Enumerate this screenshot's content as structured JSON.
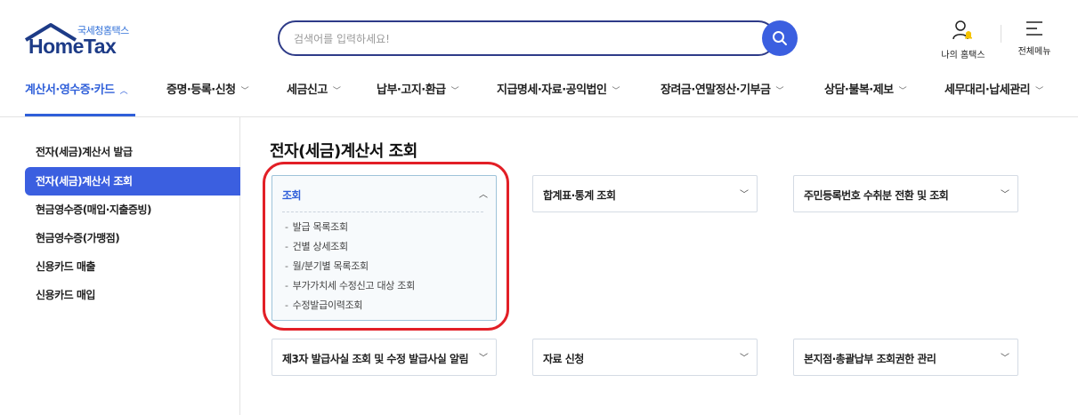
{
  "header": {
    "logo_sub": "국세청홈택스",
    "logo_main": "HomeTax",
    "search_placeholder": "검색어를 입력하세요!",
    "my_hometax": "나의 홈택스",
    "all_menu": "전체메뉴"
  },
  "gnb": [
    {
      "label": "계산서·영수증·카드",
      "chev": "︿"
    },
    {
      "label": "증명·등록·신청",
      "chev": "﹀"
    },
    {
      "label": "세금신고",
      "chev": "﹀"
    },
    {
      "label": "납부·고지·환급",
      "chev": "﹀"
    },
    {
      "label": "지급명세·자료·공익법인",
      "chev": "﹀"
    },
    {
      "label": "장려금·연말정산·기부금",
      "chev": "﹀"
    },
    {
      "label": "상담·불복·제보",
      "chev": "﹀"
    },
    {
      "label": "세무대리·납세관리",
      "chev": "﹀"
    }
  ],
  "sidebar": [
    {
      "label": "전자(세금)계산서 발급"
    },
    {
      "label": "전자(세금)계산서 조회"
    },
    {
      "label": "현금영수증(매입·지출증빙)"
    },
    {
      "label": "현금영수증(가맹점)"
    },
    {
      "label": "신용카드 매출"
    },
    {
      "label": "신용카드 매입"
    }
  ],
  "main": {
    "title": "전자(세금)계산서 조회",
    "cards": [
      {
        "label": "조회",
        "chev": "︿",
        "items": [
          "발급 목록조회",
          "건별 상세조회",
          "월/분기별 목록조회",
          "부가가치세 수정신고 대상 조회",
          "수정발급이력조회"
        ]
      },
      {
        "label": "합계표·통계 조회",
        "chev": "﹀"
      },
      {
        "label": "주민등록번호 수취분 전환 및 조회",
        "chev": "﹀"
      },
      {
        "label": "제3자 발급사실 조회 및 수정 발급사실 알림",
        "chev": "﹀"
      },
      {
        "label": "자료 신청",
        "chev": "﹀"
      },
      {
        "label": "본지점·총괄납부 조회권한 관리",
        "chev": "﹀"
      }
    ]
  },
  "colors": {
    "accent": "#3b5fe0",
    "brand_navy": "#1d3b87",
    "highlight_red": "#e21f26"
  }
}
